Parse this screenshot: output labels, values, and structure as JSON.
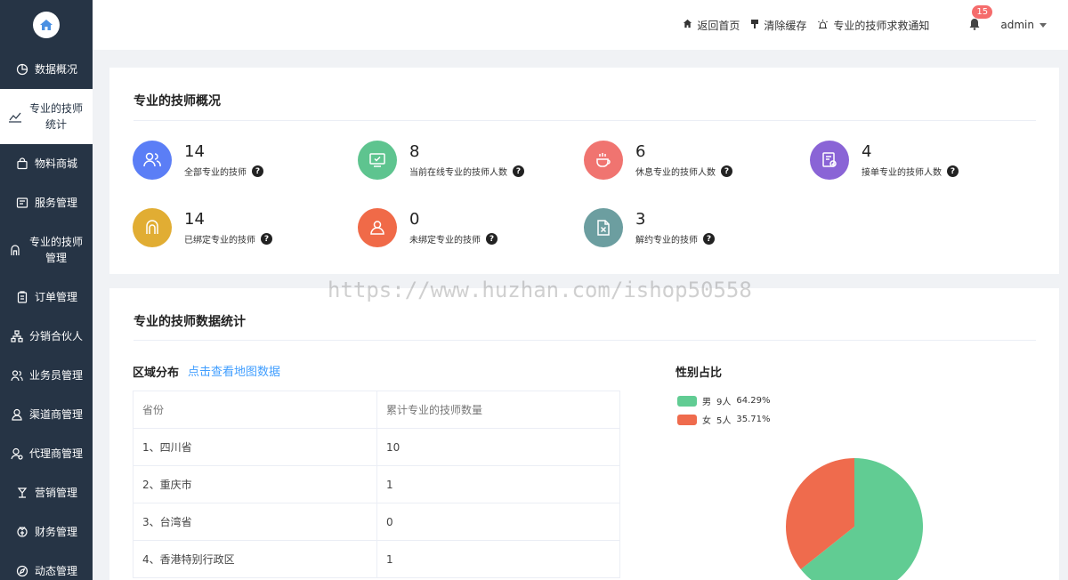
{
  "sidebar": {
    "items": [
      {
        "label": "数据概况",
        "icon": "pie-chart-icon"
      },
      {
        "label": "专业的技师统计",
        "icon": "line-chart-icon",
        "active": true
      },
      {
        "label": "物料商城",
        "icon": "shopping-bag-icon"
      },
      {
        "label": "服务管理",
        "icon": "service-icon"
      },
      {
        "label": "专业的技师管理",
        "icon": "technician-icon"
      },
      {
        "label": "订单管理",
        "icon": "clipboard-icon"
      },
      {
        "label": "分销合伙人",
        "icon": "network-icon"
      },
      {
        "label": "业务员管理",
        "icon": "users-icon"
      },
      {
        "label": "渠道商管理",
        "icon": "user-icon"
      },
      {
        "label": "代理商管理",
        "icon": "agent-icon"
      },
      {
        "label": "营销管理",
        "icon": "marketing-icon"
      },
      {
        "label": "财务管理",
        "icon": "finance-icon"
      },
      {
        "label": "动态管理",
        "icon": "compass-icon"
      }
    ]
  },
  "header": {
    "home": "返回首页",
    "clear_cache": "清除缓存",
    "rescue": "专业的技师求救通知",
    "notification_count": "15",
    "user": "admin"
  },
  "overview": {
    "title": "专业的技师概况",
    "stats": [
      {
        "value": "14",
        "label": "全部专业的技师",
        "color": "#5b7ef6",
        "icon": "users-icon"
      },
      {
        "value": "8",
        "label": "当前在线专业的技师人数",
        "color": "#5ec48f",
        "icon": "monitor-icon"
      },
      {
        "value": "6",
        "label": "休息专业的技师人数",
        "color": "#f07470",
        "icon": "coffee-icon"
      },
      {
        "value": "4",
        "label": "接单专业的技师人数",
        "color": "#8a64d6",
        "icon": "order-check-icon"
      },
      {
        "value": "14",
        "label": "已绑定专业的技师",
        "color": "#e1ad33",
        "icon": "bound-icon"
      },
      {
        "value": "0",
        "label": "未绑定专业的技师",
        "color": "#f06a48",
        "icon": "person-icon"
      },
      {
        "value": "3",
        "label": "解约专业的技师",
        "color": "#6c9ea0",
        "icon": "cancel-file-icon"
      }
    ]
  },
  "statistics": {
    "title": "专业的技师数据统计",
    "region_title": "区域分布",
    "map_link": "点击查看地图数据",
    "table": {
      "headers": [
        "省份",
        "累计专业的技师数量"
      ],
      "rows": [
        [
          "1、四川省",
          "10"
        ],
        [
          "2、重庆市",
          "1"
        ],
        [
          "3、台湾省",
          "0"
        ],
        [
          "4、香港特别行政区",
          "1"
        ]
      ]
    },
    "gender_title": "性别占比"
  },
  "chart_data": {
    "type": "pie",
    "title": "性别占比",
    "slices": [
      {
        "name": "男",
        "count": "9人",
        "percent": "64.29%",
        "value": 64.29,
        "color": "#61cc93"
      },
      {
        "name": "女",
        "count": "5人",
        "percent": "35.71%",
        "value": 35.71,
        "color": "#ef6b4d"
      }
    ],
    "legend": "top-left"
  },
  "watermark": "https://www.huzhan.com/ishop50558"
}
